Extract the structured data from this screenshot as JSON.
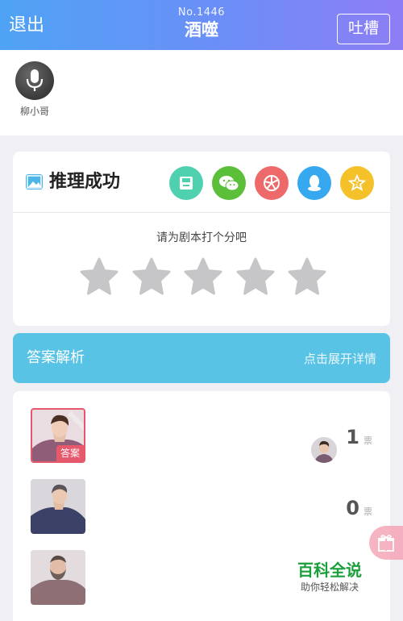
{
  "header": {
    "back_label": "退出",
    "puzzle_no": "No.1446",
    "title": "酒噬",
    "feedback_label": "吐槽",
    "gradient_colors": [
      "#4fa3f5",
      "#8e7ef5"
    ]
  },
  "host": {
    "name": "柳小哥",
    "avatar_icon": "microphone-icon"
  },
  "result": {
    "title": "推理成功",
    "share_buttons": [
      {
        "icon": "save-icon",
        "color": "#4fd1b0"
      },
      {
        "icon": "wechat-icon",
        "color": "#5cbf3a"
      },
      {
        "icon": "moments-icon",
        "color": "#ee6a6a"
      },
      {
        "icon": "qq-icon",
        "color": "#35a8f0"
      },
      {
        "icon": "favorite-icon",
        "color": "#f5c12b"
      }
    ],
    "rate_prompt": "请为剧本打个分吧",
    "star_count": 5,
    "rating": 0
  },
  "answer_bar": {
    "label": "答案解析",
    "more_label": "点击展开详情",
    "color": "#59c3e6"
  },
  "votes": [
    {
      "is_answer": true,
      "answer_tag": "答案",
      "count": "1",
      "unit": "票",
      "has_voter": true
    },
    {
      "is_answer": false,
      "count": "0",
      "unit": "票",
      "has_voter": false
    },
    {
      "is_answer": false,
      "has_voter": false
    }
  ],
  "watermark": {
    "main": "百科全说",
    "sub": "助你轻松解决"
  }
}
